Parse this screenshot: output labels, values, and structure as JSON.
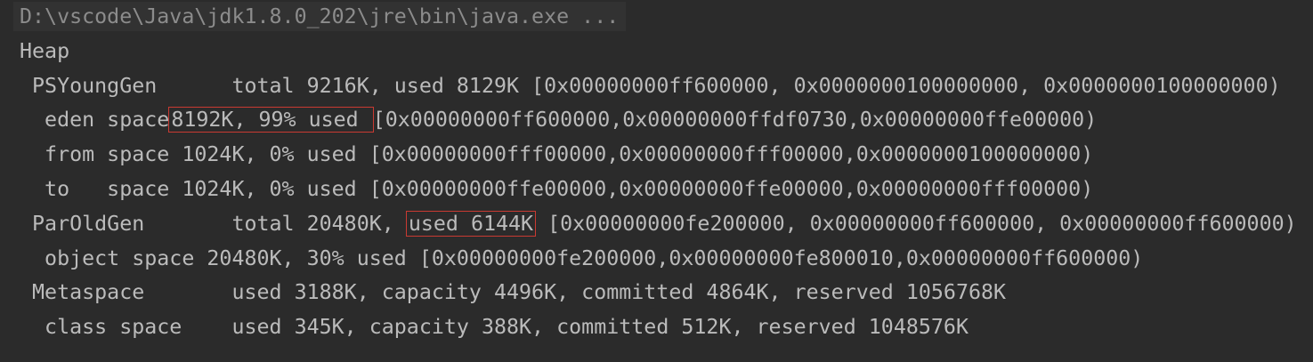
{
  "console": {
    "command": "D:\\vscode\\Java\\jdk1.8.0_202\\jre\\bin\\java.exe ...",
    "heap_title": "Heap",
    "young_gen": " PSYoungGen      total 9216K, used 8129K [0x00000000ff600000, 0x0000000100000000, 0x0000000100000000)",
    "eden_prefix": "  eden space",
    "eden_highlight": "8192K, 99% used ",
    "eden_suffix": "[0x00000000ff600000,0x00000000ffdf0730,0x00000000ffe00000)",
    "from_space": "  from space 1024K, 0% used [0x00000000fff00000,0x00000000fff00000,0x0000000100000000)",
    "to_space": "  to   space 1024K, 0% used [0x00000000ffe00000,0x00000000ffe00000,0x00000000fff00000)",
    "old_gen_prefix": " ParOldGen       total 20480K, ",
    "old_gen_highlight": "used 6144K",
    "old_gen_suffix": " [0x00000000fe200000, 0x00000000ff600000, 0x00000000ff600000)",
    "object_space": "  object space 20480K, 30% used [0x00000000fe200000,0x00000000fe800010,0x00000000ff600000)",
    "metaspace": " Metaspace       used 3188K, capacity 4496K, committed 4864K, reserved 1056768K",
    "class_space": "  class space    used 345K, capacity 388K, committed 512K, reserved 1048576K"
  },
  "colors": {
    "background": "#2b2b2b",
    "text": "#bbbbbb",
    "command_text": "#8c8c8c",
    "highlight_box": "#c93a32"
  }
}
